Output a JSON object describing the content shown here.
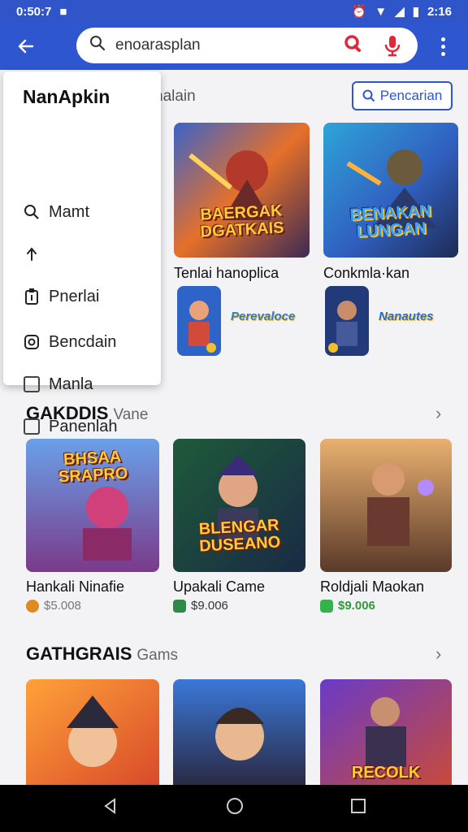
{
  "status": {
    "time": "0:50:7",
    "icon_left": "■",
    "clock_right": "2:16"
  },
  "search": {
    "value": "enoarasplan"
  },
  "menu": {
    "title": "NanApkin",
    "items": [
      {
        "label": "Mamt",
        "icon": "search-icon"
      },
      {
        "label": "",
        "icon": "share-icon"
      },
      {
        "label": "Pnerlai",
        "icon": "clipboard-icon"
      },
      {
        "label": "Bencdain",
        "icon": "instagram-icon"
      },
      {
        "label": "Manla",
        "icon": "checkbox-icon"
      },
      {
        "label": "Panenlah",
        "icon": "checkbox-icon"
      }
    ]
  },
  "top_section": {
    "label": "nalain",
    "button_label": "Pencarian",
    "cards": [
      {
        "caption": "Tenlai hanoplica",
        "banner": "BAERGAK DGATKAIS",
        "mini_label": "Perevaloce"
      },
      {
        "caption": "Conkmla·kan",
        "banner": "BENAKAN LUNGAN",
        "mini_label": "Nanautes"
      }
    ]
  },
  "section2": {
    "title": "GAKDDIS",
    "sub": "Vane",
    "cards": [
      {
        "banner": "BHSAA SRAPRO",
        "caption": "Hankali Ninafie",
        "price": "$5.008",
        "chip_color": "#e08a24",
        "price_color": "#777777"
      },
      {
        "banner": "BLENGAR DUSEANO",
        "caption": "Upakali Came",
        "price": "$9.006",
        "chip_color": "#2e8a4a",
        "price_color": "#333333"
      },
      {
        "banner": "",
        "caption": "Roldjali Maokan",
        "price": "$9.006",
        "chip_color": "#34b34a",
        "price_color": "#2e9a3c"
      }
    ]
  },
  "section3": {
    "title": "GATHGRAIS",
    "sub": "Gams",
    "cards": [
      {
        "banner": ""
      },
      {
        "banner": ""
      },
      {
        "banner": "RECOLK"
      }
    ]
  },
  "colors": {
    "accent": "#2e56cf",
    "mic": "#e3263a"
  }
}
